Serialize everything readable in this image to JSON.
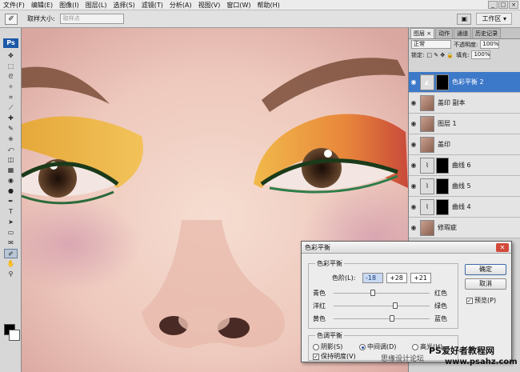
{
  "menu": [
    "文件(F)",
    "编辑(E)",
    "图像(I)",
    "图层(L)",
    "选择(S)",
    "滤镜(T)",
    "分析(A)",
    "视图(V)",
    "窗口(W)",
    "帮助(H)"
  ],
  "window_controls": {
    "minimize": "_",
    "restore": "□",
    "close": "×"
  },
  "options_bar": {
    "tool_icon": "eyedropper-icon",
    "sample_size_label": "取样大小:",
    "sample_size_value": "取样点",
    "workspace_label": "工作区 ▾"
  },
  "toolbox": {
    "logo": "Ps",
    "tools": [
      "move-tool",
      "marquee-tool",
      "lasso-tool",
      "magic-wand-tool",
      "crop-tool",
      "slice-tool",
      "healing-brush-tool",
      "brush-tool",
      "clone-stamp-tool",
      "history-brush-tool",
      "eraser-tool",
      "gradient-tool",
      "blur-tool",
      "dodge-tool",
      "pen-tool",
      "type-tool",
      "path-selection-tool",
      "shape-tool",
      "notes-tool",
      "eyedropper-tool",
      "hand-tool",
      "zoom-tool"
    ],
    "glyphs": [
      "✥",
      "⬚",
      "ᘓ",
      "✧",
      "⌗",
      "⟋",
      "✚",
      "✎",
      "⎈",
      "⤺",
      "◫",
      "▦",
      "◉",
      "●",
      "✒",
      "T",
      "➤",
      "▭",
      "✉",
      "✐",
      "✋",
      "⚲"
    ],
    "active_tool": "eyedropper-tool"
  },
  "layers_panel": {
    "tabs": [
      "图层 ×",
      "动作",
      "通道",
      "历史记录"
    ],
    "blend_mode": "正常",
    "opacity_label": "不透明度:",
    "opacity": "100%",
    "lock_label": "锁定:",
    "fill_label": "填充:",
    "fill": "100%",
    "layers": [
      {
        "name": "色彩平衡 2",
        "thumb": "◭",
        "selected": true,
        "mask": true
      },
      {
        "name": "盖印 副本",
        "thumb": "",
        "selected": false,
        "mask": false
      },
      {
        "name": "图层 1",
        "thumb": "",
        "selected": false,
        "mask": false
      },
      {
        "name": "盖印",
        "thumb": "",
        "selected": false,
        "mask": false
      },
      {
        "name": "曲线 6",
        "thumb": "⌇",
        "selected": false,
        "mask": true
      },
      {
        "name": "曲线 5",
        "thumb": "⌇",
        "selected": false,
        "mask": true
      },
      {
        "name": "曲线 4",
        "thumb": "⌇",
        "selected": false,
        "mask": true
      },
      {
        "name": "修瑕疵",
        "thumb": "",
        "selected": false,
        "mask": false
      }
    ]
  },
  "color_balance_dialog": {
    "title": "色彩平衡",
    "balance_group": "色彩平衡",
    "levels_label": "色阶(L):",
    "levels": [
      "-18",
      "+28",
      "+21"
    ],
    "sliders": [
      {
        "left": "青色",
        "right": "红色",
        "value": -18
      },
      {
        "left": "洋红",
        "right": "绿色",
        "value": 28
      },
      {
        "left": "黄色",
        "right": "蓝色",
        "value": 21
      }
    ],
    "tone_group": "色调平衡",
    "shadows_label": "阴影(S)",
    "midtones_label": "中间调(D)",
    "highlights_label": "高光(H)",
    "preserve_label": "保持明度(V)",
    "ok_label": "确定",
    "cancel_label": "取消",
    "preview_label": "预览(P)"
  },
  "watermark": {
    "text1": "思缘设计论坛",
    "text2": "PS爱好者教程网",
    "text3": "www.psahz.com"
  }
}
